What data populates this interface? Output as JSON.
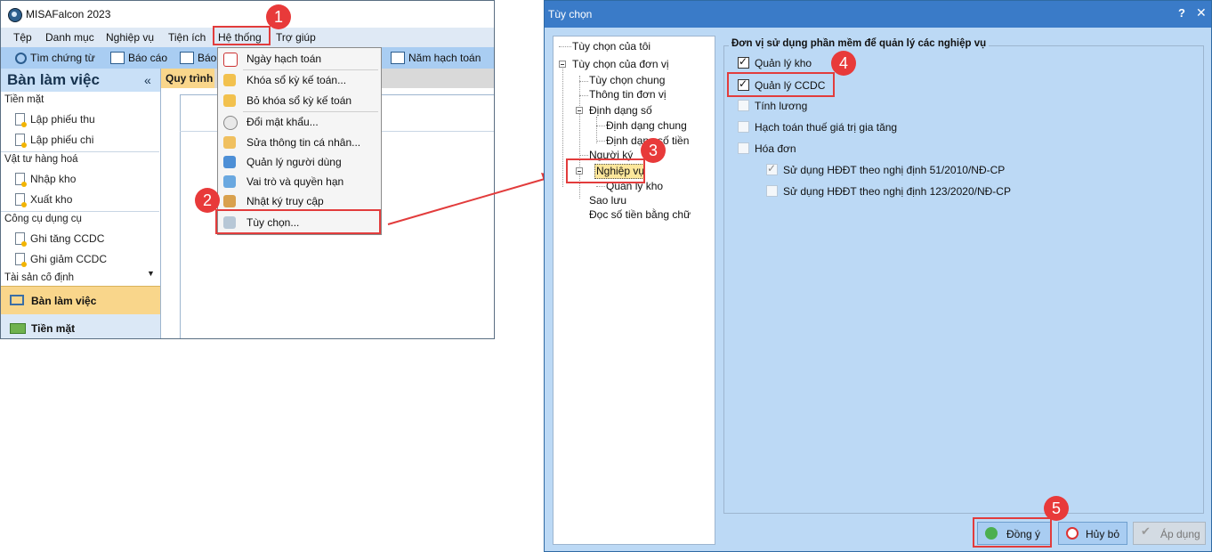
{
  "app": {
    "title": "MISAFalcon 2023",
    "menu": [
      "Tệp",
      "Danh mục",
      "Nghiệp vụ",
      "Tiện ích",
      "Hệ thống",
      "Trợ giúp"
    ],
    "toolbar": {
      "search": "Tìm chứng từ",
      "report": "Báo cáo",
      "report2": "Báo",
      "year": "Năm hạch toán"
    },
    "sidebar": {
      "title": "Bàn làm việc",
      "collapse": "«",
      "groups": [
        {
          "label": "Tiền mặt",
          "items": [
            "Lập phiếu thu",
            "Lập phiếu chi"
          ]
        },
        {
          "label": "Vật tư hàng hoá",
          "items": [
            "Nhập kho",
            "Xuất kho"
          ]
        },
        {
          "label": "Công cụ dụng cụ",
          "items": [
            "Ghi tăng CCDC",
            "Ghi giảm CCDC"
          ]
        },
        {
          "label": "Tài sản cố định",
          "items": []
        }
      ],
      "nav": [
        "Bàn làm việc",
        "Tiền mặt"
      ]
    },
    "tab_label": "Quy trình",
    "dropdown": [
      "Ngày hạch toán",
      "Khóa sổ kỳ kế toán...",
      "Bỏ khóa sổ kỳ kế toán",
      "Đổi mật khẩu...",
      "Sửa thông tin cá nhân...",
      "Quản lý người dùng",
      "Vai trò và quyền hạn",
      "Nhật ký truy cập",
      "Tùy chọn..."
    ]
  },
  "dialog": {
    "title": "Tùy chọn",
    "help": "?",
    "close": "✕",
    "tree": [
      "Tùy chọn của tôi",
      "Tùy chọn của đơn vị",
      "Tùy chọn chung",
      "Thông tin đơn vị",
      "Định dạng số",
      "Định dạng chung",
      "Định dạng số tiền",
      "Người ký",
      "Nghiệp vụ",
      "Quản lý kho",
      "Sao lưu",
      "Đọc số tiền bằng chữ"
    ],
    "section_title": "Đơn vị sử dụng phần mềm để quản lý các nghiệp vụ",
    "options": [
      {
        "label": "Quản lý kho",
        "checked": true
      },
      {
        "label": "Quản lý CCDC",
        "checked": true
      },
      {
        "label": "Tính lương",
        "checked": false
      },
      {
        "label": "Hạch toán thuế giá trị gia tăng",
        "checked": false
      },
      {
        "label": "Hóa đơn",
        "checked": false
      }
    ],
    "sub_options": [
      {
        "label": "Sử dụng HĐĐT theo nghị định 51/2010/NĐ-CP",
        "checked": true,
        "disabled": true
      },
      {
        "label": "Sử dụng HĐĐT theo nghị định 123/2020/NĐ-CP",
        "checked": false,
        "disabled": false
      }
    ],
    "buttons": {
      "ok": "Đồng ý",
      "cancel": "Hủy bỏ",
      "apply": "Áp dụng"
    }
  },
  "annotations": [
    "1",
    "2",
    "3",
    "4",
    "5"
  ],
  "colors": {
    "annotation": "#e83a3a",
    "dialog_title": "#3a7bc8",
    "dialog_bg": "#bcd9f5",
    "highlight": "#f9d68b"
  }
}
